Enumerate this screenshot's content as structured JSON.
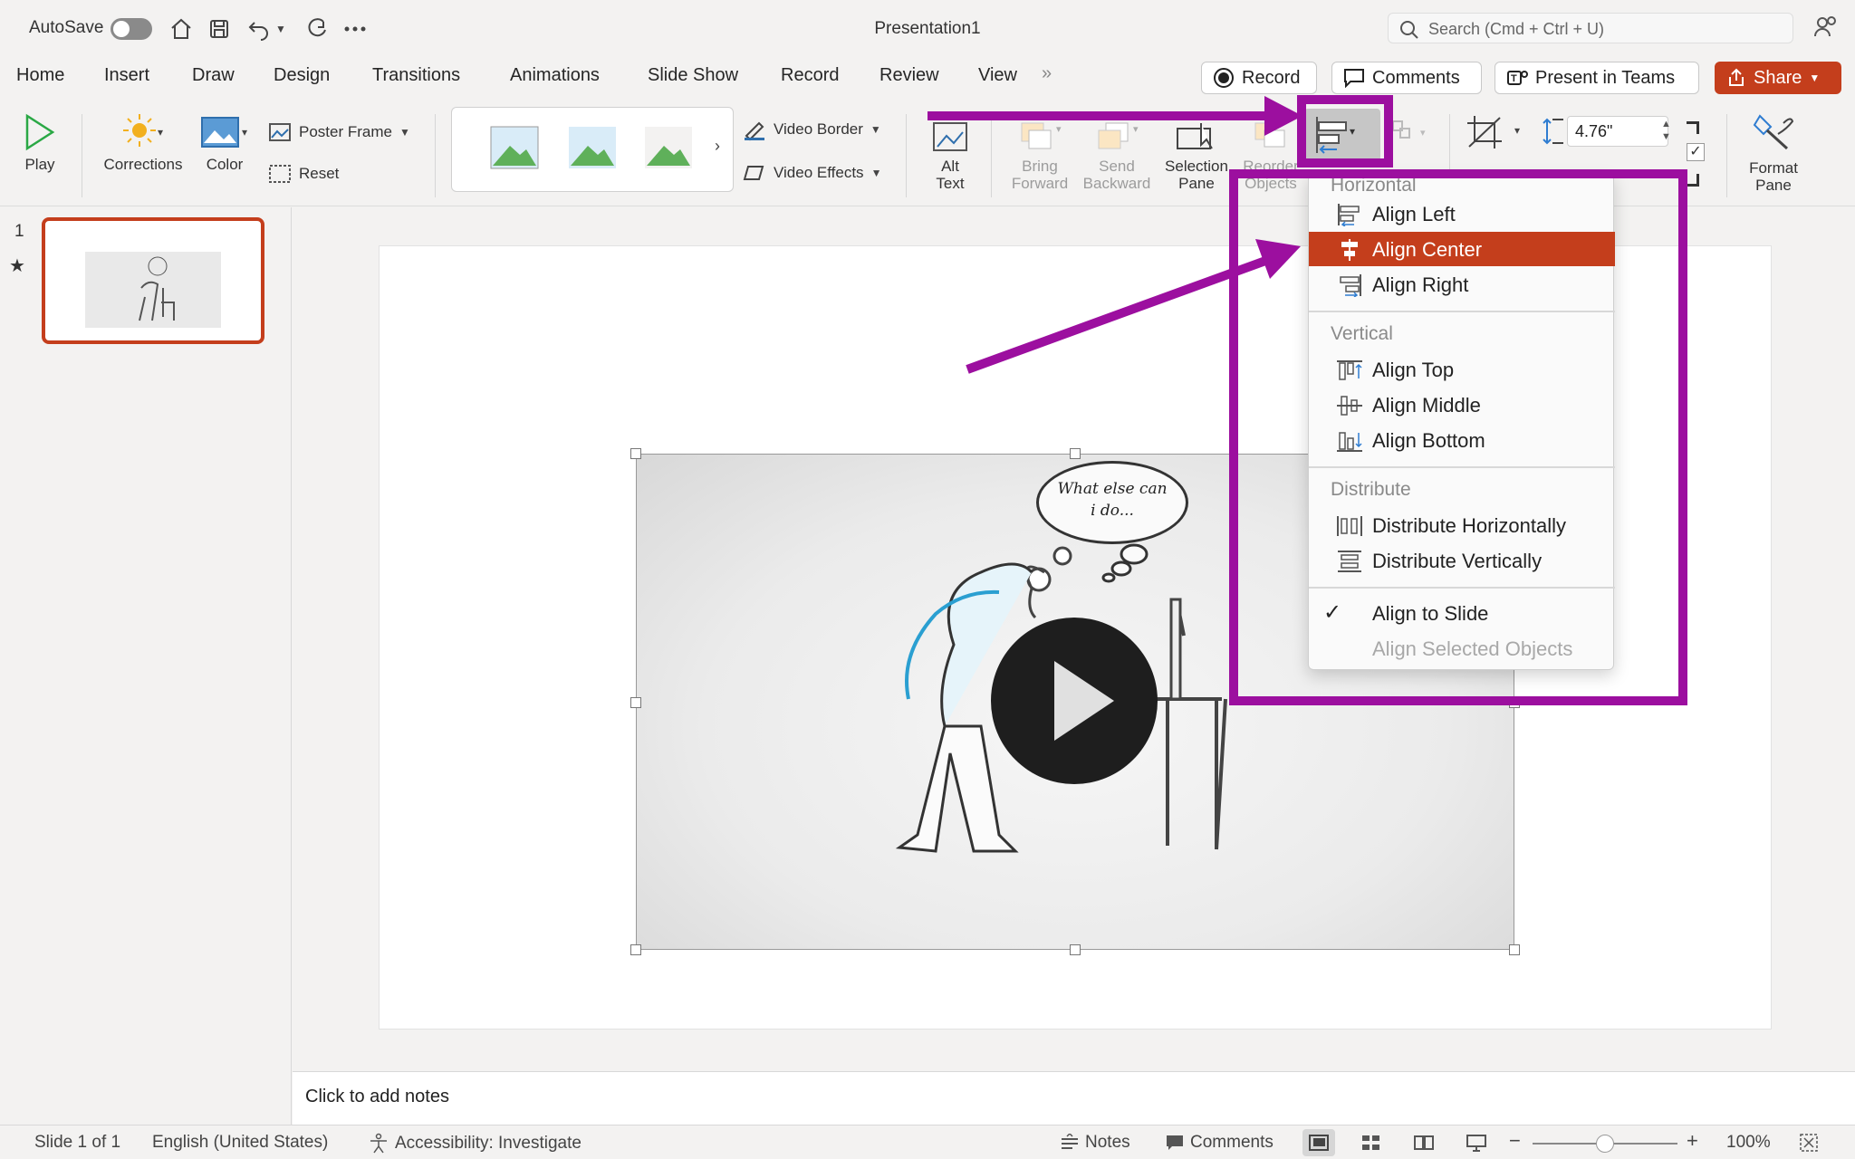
{
  "titlebar": {
    "autosave_label": "AutoSave",
    "document_title": "Presentation1",
    "search_placeholder": "Search (Cmd + Ctrl + U)",
    "icons": [
      "home-icon",
      "save-icon",
      "undo-icon",
      "redo-icon",
      "more-icon",
      "share-people-icon"
    ]
  },
  "tabs": [
    "Home",
    "Insert",
    "Draw",
    "Design",
    "Transitions",
    "Animations",
    "Slide Show",
    "Record",
    "Review",
    "View"
  ],
  "actions": {
    "record": "Record",
    "comments": "Comments",
    "present_in_teams": "Present in Teams",
    "share": "Share"
  },
  "ribbon": {
    "play": "Play",
    "corrections": "Corrections",
    "color": "Color",
    "poster_frame": "Poster Frame",
    "reset": "Reset",
    "video_border": "Video Border",
    "video_effects": "Video Effects",
    "alt_text": [
      "Alt",
      "Text"
    ],
    "bring_forward": [
      "Bring",
      "Forward"
    ],
    "send_backward": [
      "Send",
      "Backward"
    ],
    "selection_pane": [
      "Selection",
      "Pane"
    ],
    "reorder_objects": [
      "Reorder",
      "Objects"
    ],
    "height_value": "4.76\"",
    "format_pane": [
      "Format",
      "Pane"
    ]
  },
  "slides_pane": {
    "slide_number": "1",
    "star": "★"
  },
  "video": {
    "thought_text": [
      "What else can",
      "i do..."
    ]
  },
  "align_menu": {
    "horizontal_header": "Horizontal",
    "align_left": "Align Left",
    "align_center": "Align Center",
    "align_right": "Align Right",
    "vertical_header": "Vertical",
    "align_top": "Align Top",
    "align_middle": "Align Middle",
    "align_bottom": "Align Bottom",
    "distribute_header": "Distribute",
    "distribute_horizontally": "Distribute Horizontally",
    "distribute_vertically": "Distribute Vertically",
    "align_to_slide": "Align to Slide",
    "align_selected_objects": "Align Selected Objects",
    "selected_item": "Align Center",
    "checked_item": "Align to Slide"
  },
  "notes": {
    "placeholder": "Click to add notes"
  },
  "statusbar": {
    "slide_count": "Slide 1 of 1",
    "language": "English (United States)",
    "accessibility": "Accessibility: Investigate",
    "notes": "Notes",
    "comments": "Comments",
    "zoom_minus": "−",
    "zoom_plus": "+",
    "zoom": "100%"
  },
  "colors": {
    "accent": "#c43e1c",
    "annotation": "#9c0f9f",
    "ribbon_bg": "#f3f2f1"
  }
}
